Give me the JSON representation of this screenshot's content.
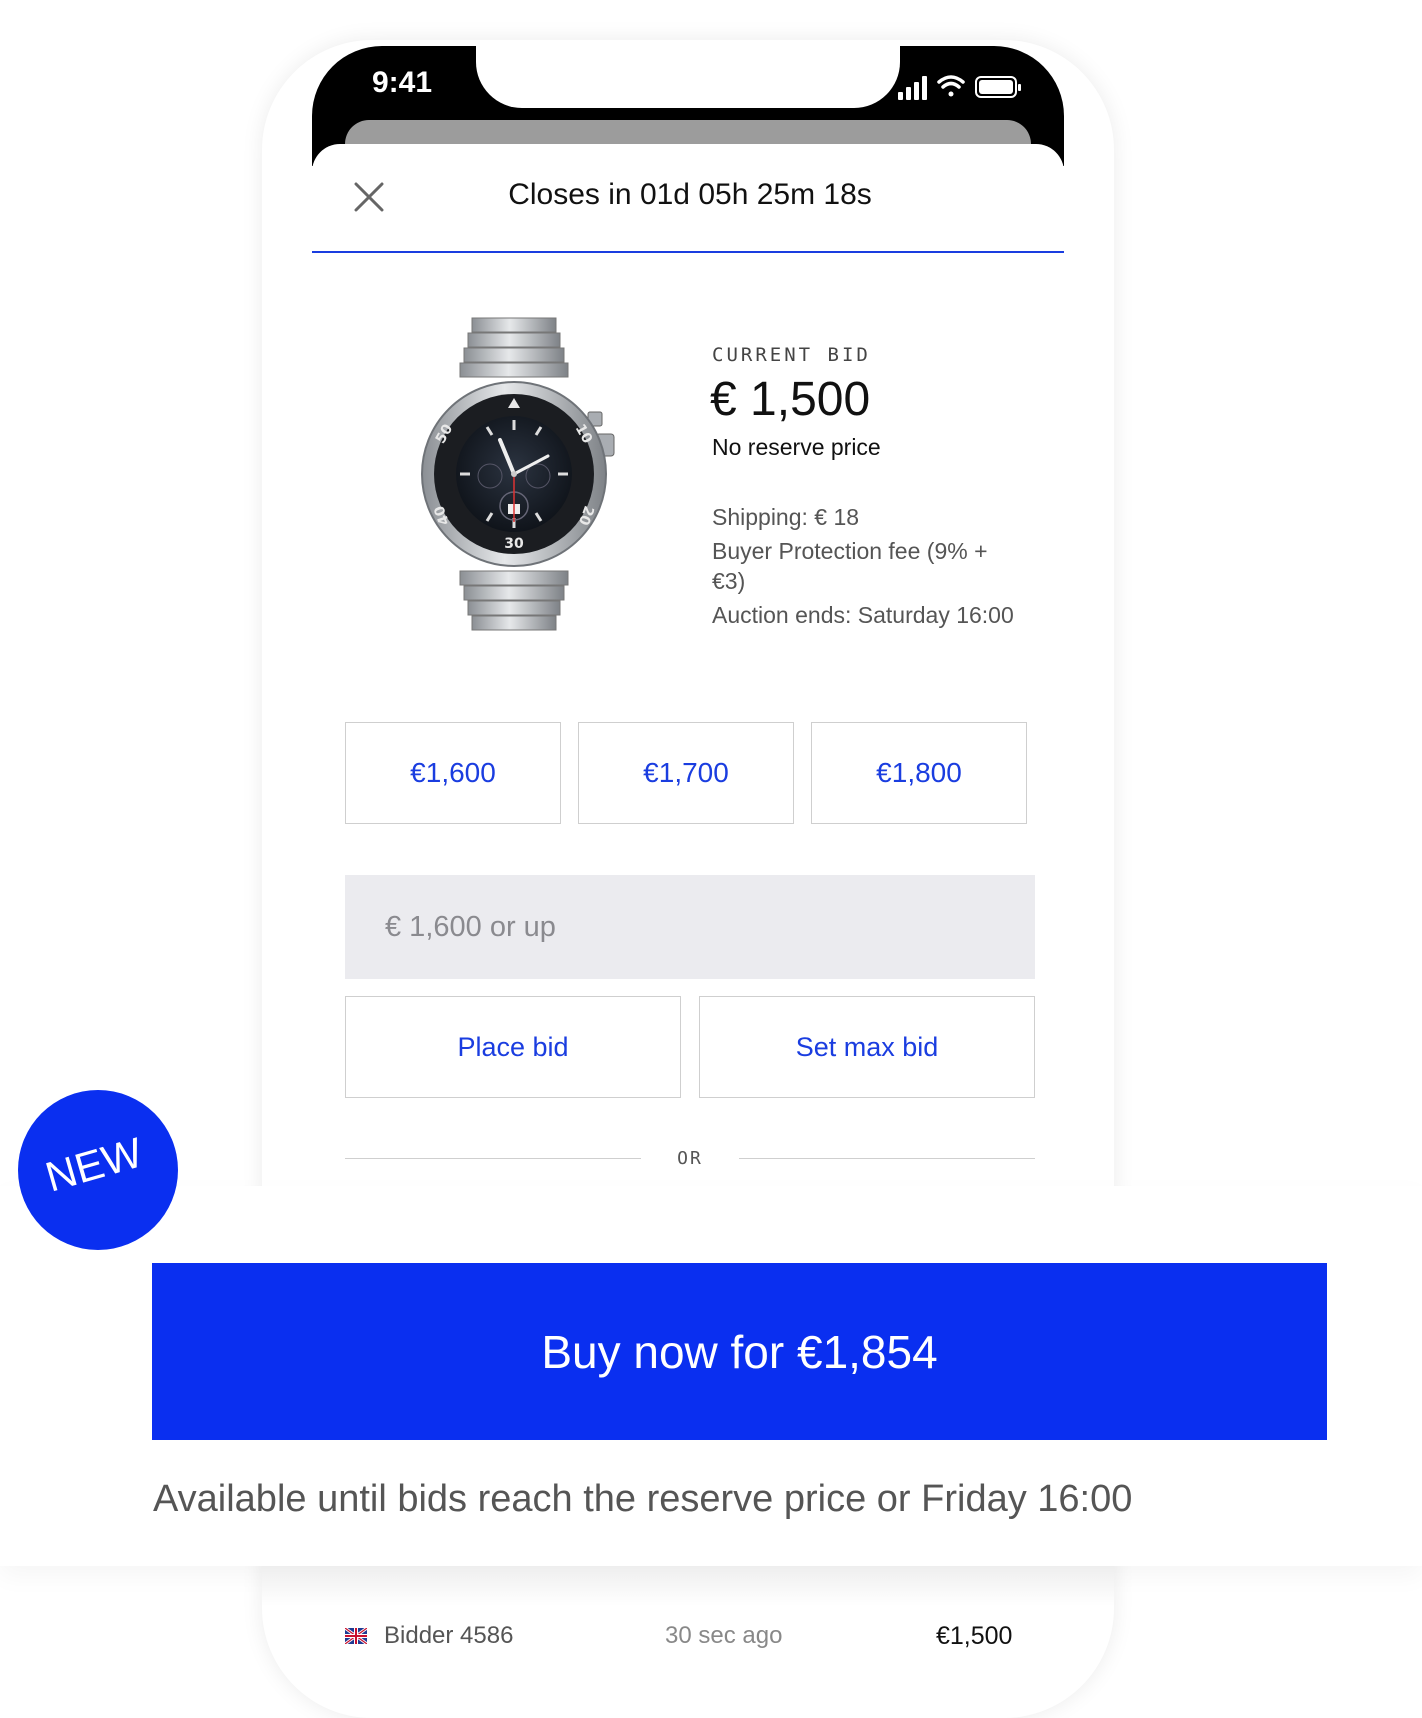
{
  "status_bar": {
    "time": "9:41",
    "signal_icon": "signal-bars-icon",
    "wifi_icon": "wifi-icon",
    "battery_icon": "battery-icon"
  },
  "header": {
    "close_icon": "close-icon",
    "countdown": "Closes in 01d 05h 25m 18s"
  },
  "product": {
    "image_icon": "watch-image",
    "current_bid_label": "CURRENT BID",
    "current_bid_value": "€ 1,500",
    "reserve_text": "No reserve price",
    "details": {
      "shipping": "Shipping: € 18",
      "buyer_protection": "Buyer Protection fee (9% + €3)",
      "auction_ends": "Auction ends: Saturday 16:00"
    }
  },
  "quick_bids": [
    "€1,600",
    "€1,700",
    "€1,800"
  ],
  "bid_input": {
    "placeholder": "€ 1,600 or up",
    "value": ""
  },
  "actions": {
    "place_bid": "Place bid",
    "set_max_bid": "Set max bid",
    "or_text": "OR"
  },
  "buy_now": {
    "label": "Buy now for €1,854",
    "availability": "Available until bids reach the reserve price or Friday 16:00"
  },
  "badge": {
    "label": "NEW"
  },
  "bid_history": [
    {
      "flag_icon": "uk-flag-icon",
      "bidder": "Bidder 4586",
      "time": "30 sec ago",
      "amount": "€1,500"
    }
  ],
  "colors": {
    "accent_blue": "#0a2ff0",
    "link_blue": "#1a3de0",
    "input_background": "#ebebef",
    "border_gray": "#cfcfcf"
  }
}
